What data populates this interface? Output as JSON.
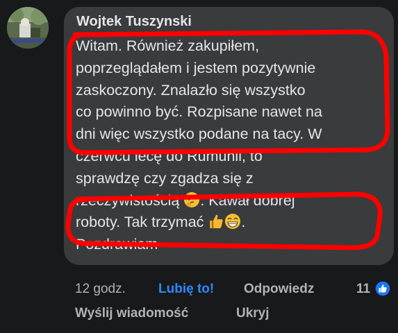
{
  "comment": {
    "author": "Wojtek Tuszynski",
    "lines": [
      "Witam. Również zakupiłem,",
      "poprzeglądałem i jestem pozytywnie",
      "zaskoczony. Znalazło się wszystko",
      "co powinno być. Rozpisane nawet na",
      "dni więc wszystko podane na tacy. W",
      "czerwcu lecę do Rumunii, to",
      "sprawdzę czy zgadza się z"
    ],
    "line8_text": "rzeczywistością",
    "line8_emoji": "thinking-face-emoji",
    "line8_after": ". Kawał dobrej",
    "line9_text": "roboty. Tak trzymać",
    "line9_emojis": [
      "thumbs-up-emoji",
      "grinning-face-emoji"
    ],
    "line9_after": ".",
    "line10": "Pozdrawiam"
  },
  "actions": {
    "time": "12 godz.",
    "like": "Lubię to!",
    "reply": "Odpowiedz",
    "send_message": "Wyślij wiadomość",
    "hide": "Ukryj"
  },
  "reactions": {
    "count": "11",
    "icon": "like-reaction-icon"
  },
  "colors": {
    "background": "#18191a",
    "bubble": "#3a3b3c",
    "text": "#e4e6eb",
    "secondary": "#b0b3b8",
    "like_blue": "#2d88ff",
    "annotation_red": "#ff0000"
  }
}
